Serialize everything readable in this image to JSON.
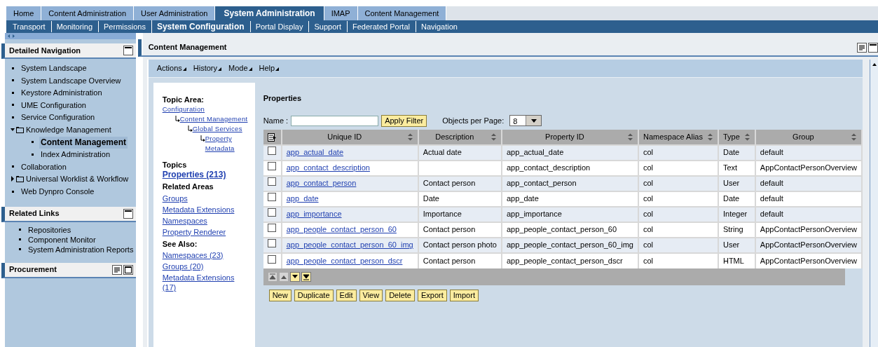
{
  "top_tabs": [
    {
      "label": "Home",
      "selected": false
    },
    {
      "label": "Content Administration",
      "selected": false
    },
    {
      "label": "User Administration",
      "selected": false
    },
    {
      "label": "System Administration",
      "selected": true
    },
    {
      "label": "IMAP",
      "selected": false
    },
    {
      "label": "Content Management",
      "selected": false
    }
  ],
  "sub_nav": [
    {
      "label": "Transport",
      "selected": false
    },
    {
      "label": "Monitoring",
      "selected": false
    },
    {
      "label": "Permissions",
      "selected": false
    },
    {
      "label": "System Configuration",
      "selected": true
    },
    {
      "label": "Portal Display",
      "selected": false
    },
    {
      "label": "Support",
      "selected": false
    },
    {
      "label": "Federated Portal",
      "selected": false
    },
    {
      "label": "Navigation",
      "selected": false
    }
  ],
  "detailed_navigation": {
    "title": "Detailed Navigation",
    "items": [
      {
        "kind": "leaf",
        "label": "System Landscape",
        "selected": false
      },
      {
        "kind": "leaf",
        "label": "System Landscape Overview",
        "selected": false
      },
      {
        "kind": "leaf",
        "label": "Keystore Administration",
        "selected": false
      },
      {
        "kind": "leaf",
        "label": "UME Configuration",
        "selected": false
      },
      {
        "kind": "leaf",
        "label": "Service Configuration",
        "selected": false
      },
      {
        "kind": "folder",
        "label": "Knowledge Management",
        "expanded": true,
        "children": [
          {
            "kind": "leaf",
            "label": "Content Management",
            "selected": true
          },
          {
            "kind": "leaf",
            "label": "Index Administration",
            "selected": false
          }
        ]
      },
      {
        "kind": "leaf",
        "label": "Collaboration",
        "selected": false
      },
      {
        "kind": "folder",
        "label": "Universal Worklist & Workflow",
        "expanded": false
      },
      {
        "kind": "leaf",
        "label": "Web Dynpro Console",
        "selected": false
      }
    ]
  },
  "related_links": {
    "title": "Related Links",
    "items": [
      "Repositories",
      "Component Monitor",
      "System Administration Reports"
    ]
  },
  "procurement": {
    "title": "Procurement"
  },
  "content": {
    "title": "Content Management",
    "menus": [
      "Actions",
      "History",
      "Mode",
      "Help"
    ],
    "topic_area": {
      "heading": "Topic Area:",
      "path": [
        {
          "label": "Configuration",
          "children": [
            {
              "label": "Content Management",
              "children": [
                {
                  "label": "Global Services",
                  "children": [
                    {
                      "label": "Property Metadata"
                    }
                  ]
                }
              ]
            }
          ]
        }
      ]
    },
    "topics": {
      "heading": "Topics",
      "link": "Properties (213)"
    },
    "related_areas": {
      "heading": "Related Areas",
      "links": [
        "Groups",
        "Metadata Extensions",
        "Namespaces",
        "Property Renderer"
      ]
    },
    "see_also": {
      "heading": "See Also:",
      "links": [
        "Namespaces (23)",
        "Groups (20)",
        "Metadata Extensions (17)"
      ]
    },
    "properties": {
      "title": "Properties",
      "name_label": "Name :",
      "apply_button": "Apply Filter",
      "per_page_label": "Objects per Page:",
      "per_page_value": "8",
      "columns": [
        "Unique ID",
        "Description",
        "Property ID",
        "Namespace Alias",
        "Type",
        "Group"
      ],
      "rows": [
        {
          "checked": false,
          "cells": [
            "app_actual_date",
            "Actual date",
            "app_actual_date",
            "col",
            "Date",
            "default"
          ]
        },
        {
          "checked": false,
          "cells": [
            "app_contact_description",
            "",
            "app_contact_description",
            "col",
            "Text",
            "AppContactPersonOverview"
          ]
        },
        {
          "checked": false,
          "cells": [
            "app_contact_person",
            "Contact person",
            "app_contact_person",
            "col",
            "User",
            "default"
          ]
        },
        {
          "checked": false,
          "cells": [
            "app_date",
            "Date",
            "app_date",
            "col",
            "Date",
            "default"
          ]
        },
        {
          "checked": false,
          "cells": [
            "app_importance",
            "Importance",
            "app_importance",
            "col",
            "Integer",
            "default"
          ]
        },
        {
          "checked": false,
          "cells": [
            "app_people_contact_person_60",
            "Contact person",
            "app_people_contact_person_60",
            "col",
            "String",
            "AppContactPersonOverview"
          ]
        },
        {
          "checked": false,
          "cells": [
            "app_people_contact_person_60_img",
            "Contact person photo",
            "app_people_contact_person_60_img",
            "col",
            "User",
            "AppContactPersonOverview"
          ]
        },
        {
          "checked": false,
          "cells": [
            "app_people_contact_person_dscr",
            "Contact person",
            "app_people_contact_person_dscr",
            "col",
            "HTML",
            "AppContactPersonOverview"
          ]
        }
      ],
      "pager": [
        {
          "kind": "first",
          "disabled": true
        },
        {
          "kind": "prev",
          "disabled": true
        },
        {
          "kind": "next",
          "disabled": false
        },
        {
          "kind": "last",
          "disabled": false
        }
      ],
      "actions": [
        "New",
        "Duplicate",
        "Edit",
        "View",
        "Delete",
        "Export",
        "Import"
      ]
    }
  }
}
